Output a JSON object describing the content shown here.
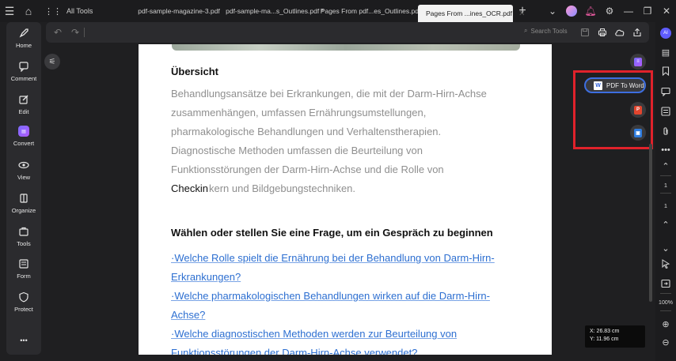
{
  "titlebar": {
    "all_tools": "All Tools",
    "tabs": [
      {
        "label": "pdf-sample-magazine-3.pdf"
      },
      {
        "label": "pdf-sample-ma...s_Outlines.pdf *"
      },
      {
        "label": "Pages  From  pdf...es_Outlines.pdf"
      },
      {
        "label": "Pages  From  ...ines_OCR.pdf"
      }
    ],
    "close_glyph": "✕",
    "add_glyph": "+"
  },
  "sidebar": {
    "items": [
      {
        "label": "Home",
        "icon": "rocket-icon"
      },
      {
        "label": "Comment",
        "icon": "comment-icon"
      },
      {
        "label": "Edit",
        "icon": "edit-icon"
      },
      {
        "label": "Convert",
        "icon": "convert-icon"
      },
      {
        "label": "View",
        "icon": "eye-icon"
      },
      {
        "label": "Organize",
        "icon": "organize-icon"
      },
      {
        "label": "Tools",
        "icon": "toolbox-icon"
      },
      {
        "label": "Form",
        "icon": "form-icon"
      },
      {
        "label": "Protect",
        "icon": "shield-icon"
      }
    ],
    "more": "•••"
  },
  "toolbar": {
    "search_label": "Search Tools"
  },
  "document": {
    "heading": "Übersicht",
    "paragraph_lines": [
      "Behandlungsansätze bei Erkrankungen, die mit der Darm-Hirn-Achse",
      "zusammenhängen, umfassen Ernährungsumstellungen,",
      "pharmakologische Behandlungen und Verhaltenstherapien.",
      "Diagnostische Methoden umfassen die Beurteilung von",
      "Funktionsstörungen der Darm-Hirn-Achse und die Rolle von",
      "kern und Bildgebungstechniken."
    ],
    "overlay_text": "Checkin",
    "question_heading": "Wählen oder stellen Sie eine Frage, um ein Gespräch zu beginnen",
    "links": [
      "·Welche Rolle spielt die Ernährung bei der Behandlung von Darm-Hirn-",
      "Erkrankungen?",
      "·Welche pharmakologischen Behandlungen wirken auf die Darm-Hirn-",
      "Achse?",
      "·Welche diagnostischen Methoden werden zur Beurteilung von",
      "Funktionsstörungen der Darm-Hirn-Achse verwendet?"
    ]
  },
  "convert_panel": {
    "pdf_to_word": "PDF To Word",
    "word_glyph": "W",
    "ppt_glyph": "P",
    "img_glyph": "▣"
  },
  "rightbar": {
    "page_current": "1",
    "page_total": "1",
    "zoom": "100%",
    "ai_label": "AI"
  },
  "coords": {
    "x": "X:  26.83 cm",
    "y": "Y:  11.96 cm"
  },
  "colors": {
    "highlight": "#e0222b",
    "accent": "#3d6ee0",
    "link": "#2d6fd1"
  }
}
